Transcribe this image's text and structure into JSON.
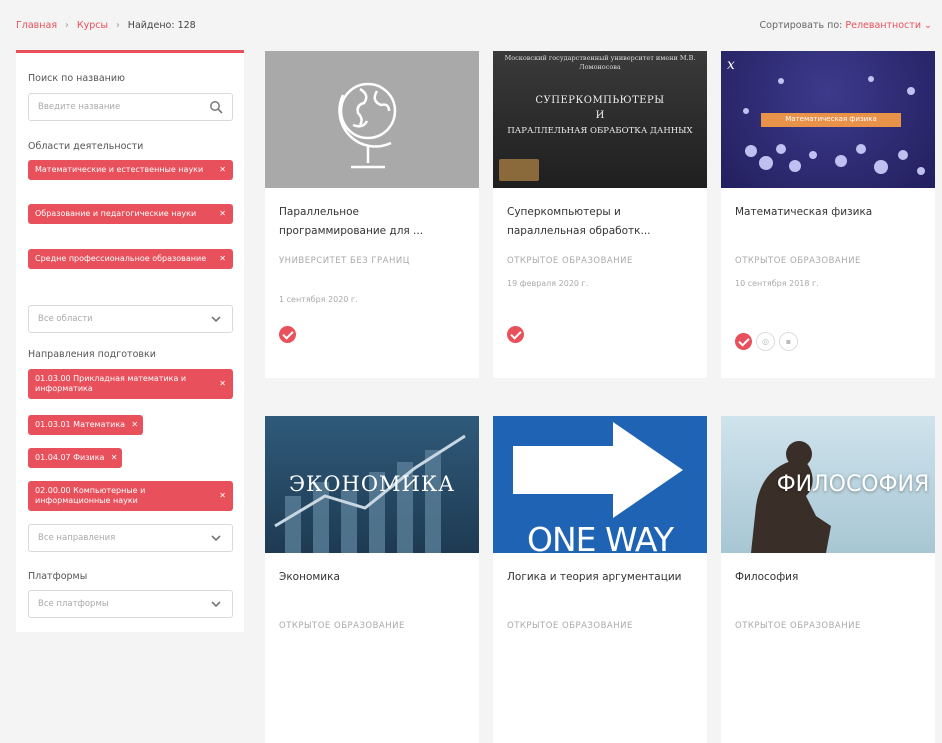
{
  "breadcrumb": {
    "home": "Главная",
    "courses": "Курсы",
    "sep": "›",
    "found": "Найдено: 128"
  },
  "sort": {
    "label": "Сортировать по:",
    "value": "Релевантности"
  },
  "sidebar": {
    "search_label": "Поиск по названию",
    "search_placeholder": "Введите название",
    "areas_label": "Области деятельности",
    "areas_tags": [
      "Математические и естественные науки",
      "Образование и педагогические науки",
      "Средне профессиональное образование"
    ],
    "areas_select": "Все области",
    "directions_label": "Направления подготовки",
    "directions_tags": [
      "01.03.00 Прикладная математика и информатика",
      "01.03.01 Математика",
      "01.04.07 Физика",
      "02.00.00 Компьютерные и информационные науки"
    ],
    "directions_select": "Все направления",
    "platforms_label": "Платформы",
    "platforms_select": "Все платформы"
  },
  "courses": [
    {
      "title": "Параллельное программирование для ...",
      "org": "УНИВЕРСИТЕТ БЕЗ ГРАНИЦ",
      "date": "1 сентября 2020 г."
    },
    {
      "title": "Суперкомпьютеры и параллельная обработк...",
      "org": "ОТКРЫТОЕ ОБРАЗОВАНИЕ",
      "date": "19 февраля 2020 г.",
      "image_text": {
        "top": "Московский государственный университет имени М.В. Ломоносова",
        "line1": "СУПЕРКОМПЬЮТЕРЫ",
        "line2": "И",
        "line3": "ПАРАЛЛЕЛЬНАЯ ОБРАБОТКА ДАННЫХ"
      }
    },
    {
      "title": "Математическая физика",
      "org": "ОТКРЫТОЕ ОБРАЗОВАНИЕ",
      "date": "10 сентября 2018 г.",
      "image_text": {
        "banner": "Математическая физика"
      }
    },
    {
      "title": "Экономика",
      "org": "ОТКРЫТОЕ ОБРАЗОВАНИЕ",
      "image_text": {
        "word": "ЭКОНОМИКА"
      }
    },
    {
      "title": "Логика и теория аргументации",
      "org": "ОТКРЫТОЕ ОБРАЗОВАНИЕ",
      "image_text": {
        "word": "ONE WAY"
      }
    },
    {
      "title": "Философия",
      "org": "ОТКРЫТОЕ ОБРАЗОВАНИЕ",
      "image_text": {
        "word": "ФИЛОСОФИЯ"
      }
    }
  ],
  "colors": {
    "accent": "#e8505b",
    "muted": "#aaaaaa"
  }
}
